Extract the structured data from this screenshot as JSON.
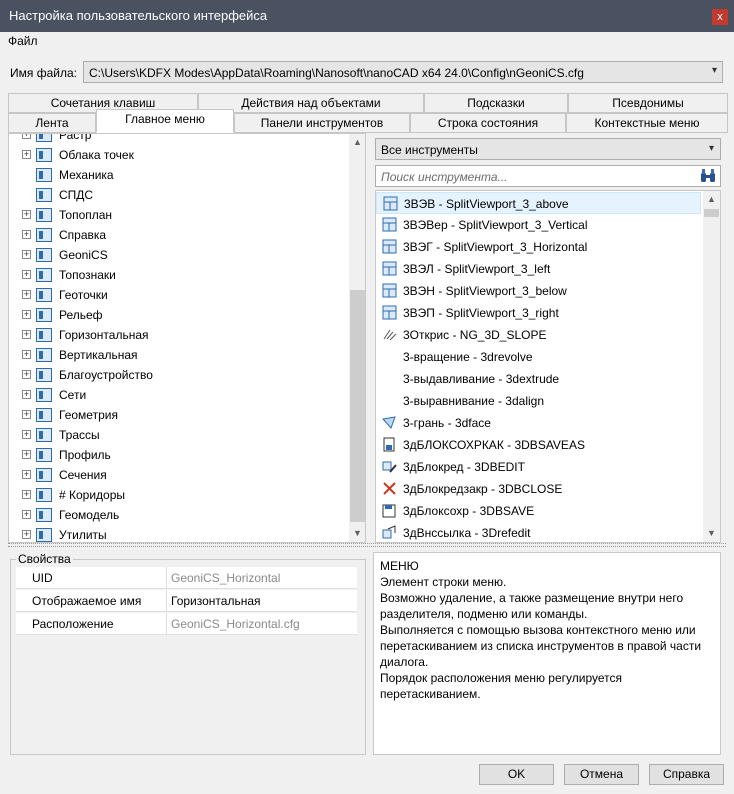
{
  "window": {
    "title": "Настройка пользовательского интерфейса",
    "close_glyph": "x"
  },
  "menu": {
    "file": "Файл"
  },
  "file": {
    "label": "Имя файла:",
    "path": "C:\\Users\\KDFX Modes\\AppData\\Roaming\\Nanosoft\\nanoCAD x64 24.0\\Config\\nGeoniCS.cfg"
  },
  "tabs": {
    "row1": [
      "Сочетания клавиш",
      "Действия над объектами",
      "Подсказки",
      "Псевдонимы"
    ],
    "row2": [
      "Лента",
      "Главное меню",
      "Панели инструментов",
      "Строка состояния",
      "Контекстные меню"
    ],
    "active": "Главное меню"
  },
  "tree": {
    "partial_top": "Растр",
    "items": [
      {
        "label": "Облака точек",
        "expandable": true
      },
      {
        "label": "Механика",
        "expandable": false
      },
      {
        "label": "СПДС",
        "expandable": false
      },
      {
        "label": "Топоплан",
        "expandable": true
      },
      {
        "label": "Справка",
        "expandable": true
      },
      {
        "label": "GeoniCS",
        "expandable": true
      },
      {
        "label": "Топознаки",
        "expandable": true
      },
      {
        "label": "Геоточки",
        "expandable": true
      },
      {
        "label": "Рельеф",
        "expandable": true
      },
      {
        "label": "Горизонтальная",
        "expandable": true
      },
      {
        "label": "Вертикальная",
        "expandable": true
      },
      {
        "label": "Благоустройство",
        "expandable": true
      },
      {
        "label": "Сети",
        "expandable": true
      },
      {
        "label": "Геометрия",
        "expandable": true
      },
      {
        "label": "Трассы",
        "expandable": true
      },
      {
        "label": "Профиль",
        "expandable": true
      },
      {
        "label": "Сечения",
        "expandable": true
      },
      {
        "label": "# Коридоры",
        "expandable": true
      },
      {
        "label": "Геомодель",
        "expandable": true
      },
      {
        "label": "Утилиты",
        "expandable": true
      }
    ]
  },
  "tools": {
    "filter": "Все инструменты",
    "search_placeholder": "Поиск инструмента...",
    "items": [
      {
        "label": "3ВЭВ - SplitViewport_3_above",
        "icon": "viewport-icon"
      },
      {
        "label": "3ВЭВер - SplitViewport_3_Vertical",
        "icon": "viewport-icon"
      },
      {
        "label": "3ВЭГ - SplitViewport_3_Horizontal",
        "icon": "viewport-icon"
      },
      {
        "label": "3ВЭЛ - SplitViewport_3_left",
        "icon": "viewport-icon"
      },
      {
        "label": "3ВЭН - SplitViewport_3_below",
        "icon": "viewport-icon"
      },
      {
        "label": "3ВЭП - SplitViewport_3_right",
        "icon": "viewport-icon"
      },
      {
        "label": "3Открис - NG_3D_SLOPE",
        "icon": "slope-icon"
      },
      {
        "label": "3-вращение - 3drevolve",
        "icon": ""
      },
      {
        "label": "3-выдавливание - 3dextrude",
        "icon": ""
      },
      {
        "label": "3-выравнивание - 3dalign",
        "icon": ""
      },
      {
        "label": "3-грань - 3dface",
        "icon": "face-icon"
      },
      {
        "label": "3дБЛОКСОХРКАК - 3DBSAVEAS",
        "icon": "block-saveas-icon"
      },
      {
        "label": "3дБлокред - 3DBEDIT",
        "icon": "block-edit-icon"
      },
      {
        "label": "3дБлокредзакр - 3DBCLOSE",
        "icon": "close-x-icon"
      },
      {
        "label": "3дБлоксохр - 3DBSAVE",
        "icon": "block-save-icon"
      },
      {
        "label": "3дВнссылка - 3Drefedit",
        "icon": "refedit-icon"
      }
    ]
  },
  "properties": {
    "legend": "Свойства",
    "rows": [
      {
        "key": "UID",
        "value": "GeoniCS_Horizontal",
        "readonly": true
      },
      {
        "key": "Отображаемое имя",
        "value": "Горизонтальная",
        "readonly": false
      },
      {
        "key": "Расположение",
        "value": "GeoniCS_Horizontal.cfg",
        "readonly": true
      }
    ]
  },
  "description": {
    "title": "МЕНЮ",
    "lines": [
      "Элемент строки меню.",
      "Возможно удаление, а также размещение внутри него разделителя, подменю или команды.",
      "Выполняется с помощью вызова контекстного меню или перетаскиванием из списка инструментов в правой части диалога.",
      "Порядок расположения меню регулируется перетаскиванием."
    ]
  },
  "buttons": {
    "ok": "OK",
    "cancel": "Отмена",
    "help": "Справка"
  },
  "colors": {
    "titlebar": "#4a5261",
    "close": "#c23a2f",
    "accent": "#2b6cb0"
  }
}
